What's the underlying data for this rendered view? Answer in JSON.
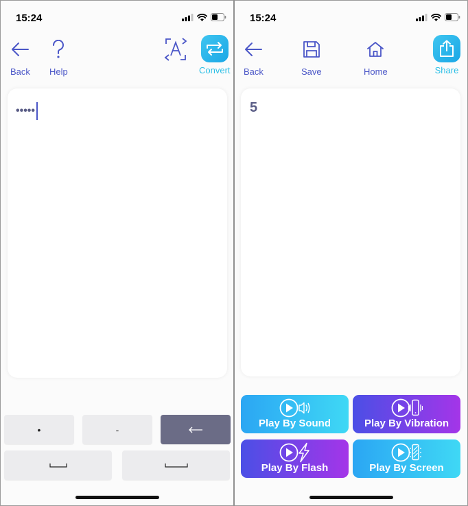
{
  "status": {
    "time": "15:24"
  },
  "encoder": {
    "toolbar": {
      "back_label": "Back",
      "help_label": "Help",
      "convert_label": "Convert"
    },
    "input_value": "•••••",
    "keys": {
      "dot": "•",
      "dash": "-",
      "backspace": "←",
      "letter_space": "⎵",
      "word_space": "⎵⎵"
    }
  },
  "decoder": {
    "toolbar": {
      "back_label": "Back",
      "save_label": "Save",
      "home_label": "Home",
      "share_label": "Share"
    },
    "result_text": "5",
    "play_buttons": [
      {
        "label": "Play By Sound",
        "icon": "play-sound-icon",
        "style": "cyan"
      },
      {
        "label": "Play By Vibration",
        "icon": "play-vibration-icon",
        "style": "violet"
      },
      {
        "label": "Play By Flash",
        "icon": "play-flash-icon",
        "style": "violet"
      },
      {
        "label": "Play By Screen",
        "icon": "play-screen-icon",
        "style": "cyan"
      }
    ]
  },
  "colors": {
    "accent_blue": "#4a56c7",
    "accent_cyan": "#2bbfe6",
    "key_dark": "#6b6c86"
  }
}
